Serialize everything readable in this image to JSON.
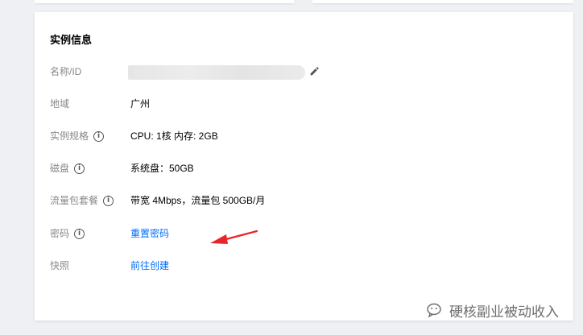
{
  "section": {
    "title": "实例信息"
  },
  "rows": [
    {
      "label": "名称/ID",
      "value": "",
      "blurred": true
    },
    {
      "label": "地域",
      "value": "广州"
    },
    {
      "label": "实例规格",
      "value": "CPU: 1核 内存: 2GB",
      "info": true
    },
    {
      "label": "磁盘",
      "value": "系统盘：50GB",
      "info": true
    },
    {
      "label": "流量包套餐",
      "value": "带宽 4Mbps，流量包 500GB/月",
      "info": true
    },
    {
      "label": "密码",
      "value": "重置密码",
      "info": true,
      "link": true
    },
    {
      "label": "快照",
      "value": "前往创建",
      "link": true
    }
  ],
  "info_icon_glyph": "i",
  "watermark": {
    "text": "硬核副业被动收入"
  },
  "colors": {
    "link": "#006eff",
    "label": "#888888",
    "annotation_arrow": "#e8262a"
  },
  "icons": {
    "edit": "pencil-icon",
    "info": "info-circle-icon",
    "watermark": "wechat-icon"
  }
}
